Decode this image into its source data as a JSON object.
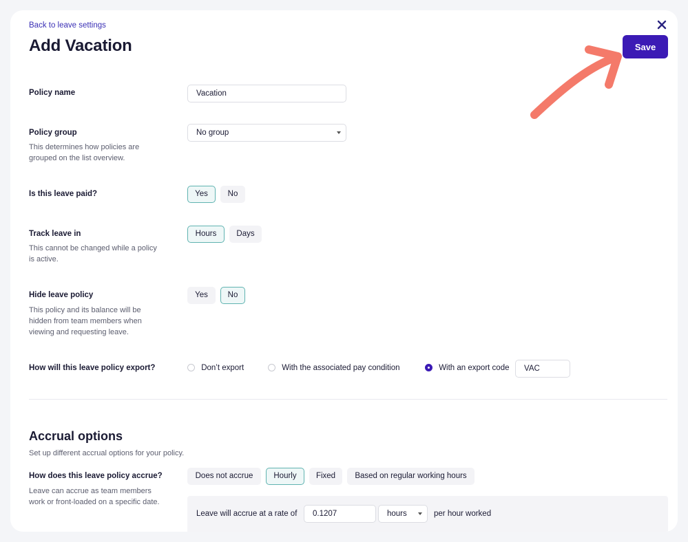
{
  "header": {
    "back_link": "Back to leave settings",
    "title": "Add Vacation",
    "close_icon": "×",
    "save_label": "Save"
  },
  "form": {
    "policy_name": {
      "label": "Policy name",
      "value": "Vacation"
    },
    "policy_group": {
      "label": "Policy group",
      "description": "This determines how policies are grouped on the list overview.",
      "value": "No group"
    },
    "paid": {
      "label": "Is this leave paid?",
      "options": [
        "Yes",
        "No"
      ],
      "selected": "Yes"
    },
    "track": {
      "label": "Track leave in",
      "description": "This cannot be changed while a policy is active.",
      "options": [
        "Hours",
        "Days"
      ],
      "selected": "Hours"
    },
    "hide": {
      "label": "Hide leave policy",
      "description": "This policy and its balance will be hidden from team members when viewing and requesting leave.",
      "options": [
        "Yes",
        "No"
      ],
      "selected": "No"
    },
    "export": {
      "label": "How will this leave policy export?",
      "options": [
        "Don’t export",
        "With the associated pay condition",
        "With an export code"
      ],
      "selected": "With an export code",
      "code_value": "VAC"
    }
  },
  "accrual": {
    "title": "Accrual options",
    "subtitle": "Set up different accrual options for your policy.",
    "method": {
      "label": "How does this leave policy accrue?",
      "description": "Leave can accrue as team members work or front-loaded on a specific date.",
      "options": [
        "Does not accrue",
        "Hourly",
        "Fixed",
        "Based on regular working hours"
      ],
      "selected": "Hourly"
    },
    "rate": {
      "prefix": "Leave will accrue at a rate of",
      "value": "0.1207",
      "unit": "hours",
      "suffix": "per hour worked"
    }
  },
  "colors": {
    "accent": "#3b1ab5",
    "selected_border": "#5fb3b0",
    "arrow": "#f47a6a"
  },
  "icons": {
    "close": "close-icon",
    "dropdown": "chevron-down-icon",
    "annotation": "curved-arrow-icon"
  }
}
